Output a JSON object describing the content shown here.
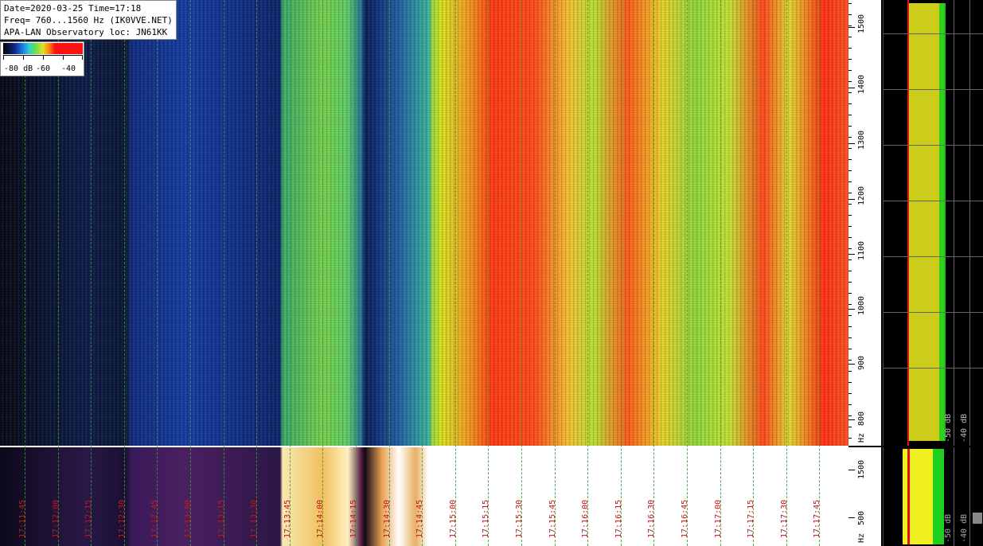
{
  "info": {
    "line1": "Date=2020-03-25 Time=17:18",
    "line2": "Freq= 760...1560 Hz (IK0VVE.NET)",
    "line3": "APA-LAN Observatory loc: JN61KK"
  },
  "color_scale": {
    "labels": [
      "-80 dB",
      "-60",
      "-40"
    ],
    "colors": [
      "#000000",
      "#102a90",
      "#2080e0",
      "#30d0d0",
      "#60e050",
      "#e0e020",
      "#ff8010",
      "#ff1010"
    ]
  },
  "time_labels": [
    "17:11:45",
    "17:12:00",
    "17:12:15",
    "17:12:30",
    "17:12:45",
    "17:13:00",
    "17:13:15",
    "17:13:30",
    "17:13:45",
    "17:14:00",
    "17:14:15",
    "17:14:30",
    "17:14:45",
    "17:15:00",
    "17:15:15",
    "17:15:30",
    "17:15:45",
    "17:16:00",
    "17:16:15",
    "17:16:30",
    "17:16:45",
    "17:17:00",
    "17:17:15",
    "17:17:30",
    "17:17:45"
  ],
  "freq_axis": {
    "labels": [
      "1500",
      "1400",
      "1300",
      "1200",
      "1100",
      "1000",
      "900",
      "800"
    ],
    "unit": "Hz"
  },
  "hist_freq_axis": {
    "labels": [
      "1500",
      "500"
    ],
    "unit": "Hz"
  },
  "spectrum_db_labels": [
    "-50 dB",
    "-40 dB"
  ],
  "hist_db_labels": [
    "-50 dB",
    "-40 dB"
  ],
  "colors": {
    "spectrum_avg": "#f0f020",
    "spectrum_peak": "#20d020",
    "marker": "#e01010"
  }
}
